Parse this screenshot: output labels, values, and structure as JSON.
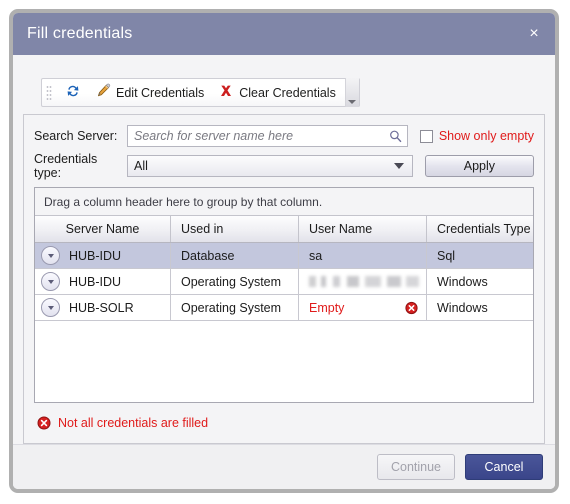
{
  "dialog": {
    "title": "Fill credentials",
    "close_label": "×"
  },
  "toolbar": {
    "refresh_label": "",
    "edit_label": "Edit Credentials",
    "clear_label": "Clear Credentials",
    "overflow_label": ""
  },
  "filters": {
    "search_label": "Search Server:",
    "search_value": "",
    "search_placeholder": "Search for server name here",
    "show_only_empty_label": "Show only empty",
    "show_only_empty_checked": false,
    "credentials_type_label": "Credentials type:",
    "credentials_type_value": "All",
    "credentials_type_options": [
      "All"
    ],
    "apply_label": "Apply"
  },
  "grid": {
    "group_hint": "Drag a column header here to group by that column.",
    "columns": [
      "Server Name",
      "Used in",
      "User Name",
      "Credentials Type",
      ""
    ],
    "rows": [
      {
        "server_name": "HUB-IDU",
        "used_in": "Database",
        "user_name": "sa",
        "user_name_redacted": false,
        "user_name_empty": false,
        "credentials_type": "Sql",
        "extra": "",
        "selected": true
      },
      {
        "server_name": "HUB-IDU",
        "used_in": "Operating System",
        "user_name": "",
        "user_name_redacted": true,
        "user_name_empty": false,
        "credentials_type": "Windows",
        "extra": "",
        "selected": false
      },
      {
        "server_name": "HUB-SOLR",
        "used_in": "Operating System",
        "user_name": "Empty",
        "user_name_redacted": false,
        "user_name_empty": true,
        "credentials_type": "Windows",
        "extra": "",
        "selected": false
      }
    ]
  },
  "status": {
    "message": "Not all credentials are filled"
  },
  "footer": {
    "continue_label": "Continue",
    "continue_disabled": true,
    "cancel_label": "Cancel"
  },
  "colors": {
    "titlebar": "#8086a8",
    "error_red": "#e01b1b",
    "primary_button": "#3f4b90",
    "row_selected": "#c3c7dd"
  },
  "icons": {
    "refresh": "refresh-icon",
    "pencil": "pencil-icon",
    "red_x": "red-x-icon",
    "magnifier": "search-icon",
    "error": "error-circle-icon",
    "chevron_down": "chevron-down-icon"
  }
}
